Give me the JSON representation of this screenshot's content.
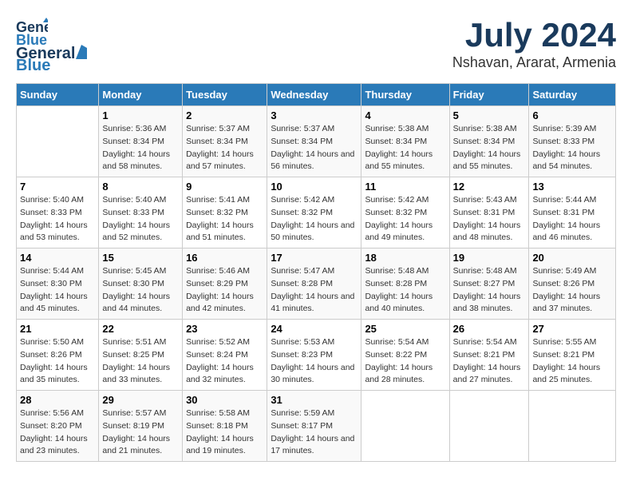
{
  "header": {
    "logo_line1": "General",
    "logo_line2": "Blue",
    "title": "July 2024",
    "subtitle": "Nshavan, Ararat, Armenia"
  },
  "weekdays": [
    "Sunday",
    "Monday",
    "Tuesday",
    "Wednesday",
    "Thursday",
    "Friday",
    "Saturday"
  ],
  "weeks": [
    [
      {
        "day": "",
        "sunrise": "",
        "sunset": "",
        "daylight": ""
      },
      {
        "day": "1",
        "sunrise": "Sunrise: 5:36 AM",
        "sunset": "Sunset: 8:34 PM",
        "daylight": "Daylight: 14 hours and 58 minutes."
      },
      {
        "day": "2",
        "sunrise": "Sunrise: 5:37 AM",
        "sunset": "Sunset: 8:34 PM",
        "daylight": "Daylight: 14 hours and 57 minutes."
      },
      {
        "day": "3",
        "sunrise": "Sunrise: 5:37 AM",
        "sunset": "Sunset: 8:34 PM",
        "daylight": "Daylight: 14 hours and 56 minutes."
      },
      {
        "day": "4",
        "sunrise": "Sunrise: 5:38 AM",
        "sunset": "Sunset: 8:34 PM",
        "daylight": "Daylight: 14 hours and 55 minutes."
      },
      {
        "day": "5",
        "sunrise": "Sunrise: 5:38 AM",
        "sunset": "Sunset: 8:34 PM",
        "daylight": "Daylight: 14 hours and 55 minutes."
      },
      {
        "day": "6",
        "sunrise": "Sunrise: 5:39 AM",
        "sunset": "Sunset: 8:33 PM",
        "daylight": "Daylight: 14 hours and 54 minutes."
      }
    ],
    [
      {
        "day": "7",
        "sunrise": "Sunrise: 5:40 AM",
        "sunset": "Sunset: 8:33 PM",
        "daylight": "Daylight: 14 hours and 53 minutes."
      },
      {
        "day": "8",
        "sunrise": "Sunrise: 5:40 AM",
        "sunset": "Sunset: 8:33 PM",
        "daylight": "Daylight: 14 hours and 52 minutes."
      },
      {
        "day": "9",
        "sunrise": "Sunrise: 5:41 AM",
        "sunset": "Sunset: 8:32 PM",
        "daylight": "Daylight: 14 hours and 51 minutes."
      },
      {
        "day": "10",
        "sunrise": "Sunrise: 5:42 AM",
        "sunset": "Sunset: 8:32 PM",
        "daylight": "Daylight: 14 hours and 50 minutes."
      },
      {
        "day": "11",
        "sunrise": "Sunrise: 5:42 AM",
        "sunset": "Sunset: 8:32 PM",
        "daylight": "Daylight: 14 hours and 49 minutes."
      },
      {
        "day": "12",
        "sunrise": "Sunrise: 5:43 AM",
        "sunset": "Sunset: 8:31 PM",
        "daylight": "Daylight: 14 hours and 48 minutes."
      },
      {
        "day": "13",
        "sunrise": "Sunrise: 5:44 AM",
        "sunset": "Sunset: 8:31 PM",
        "daylight": "Daylight: 14 hours and 46 minutes."
      }
    ],
    [
      {
        "day": "14",
        "sunrise": "Sunrise: 5:44 AM",
        "sunset": "Sunset: 8:30 PM",
        "daylight": "Daylight: 14 hours and 45 minutes."
      },
      {
        "day": "15",
        "sunrise": "Sunrise: 5:45 AM",
        "sunset": "Sunset: 8:30 PM",
        "daylight": "Daylight: 14 hours and 44 minutes."
      },
      {
        "day": "16",
        "sunrise": "Sunrise: 5:46 AM",
        "sunset": "Sunset: 8:29 PM",
        "daylight": "Daylight: 14 hours and 42 minutes."
      },
      {
        "day": "17",
        "sunrise": "Sunrise: 5:47 AM",
        "sunset": "Sunset: 8:28 PM",
        "daylight": "Daylight: 14 hours and 41 minutes."
      },
      {
        "day": "18",
        "sunrise": "Sunrise: 5:48 AM",
        "sunset": "Sunset: 8:28 PM",
        "daylight": "Daylight: 14 hours and 40 minutes."
      },
      {
        "day": "19",
        "sunrise": "Sunrise: 5:48 AM",
        "sunset": "Sunset: 8:27 PM",
        "daylight": "Daylight: 14 hours and 38 minutes."
      },
      {
        "day": "20",
        "sunrise": "Sunrise: 5:49 AM",
        "sunset": "Sunset: 8:26 PM",
        "daylight": "Daylight: 14 hours and 37 minutes."
      }
    ],
    [
      {
        "day": "21",
        "sunrise": "Sunrise: 5:50 AM",
        "sunset": "Sunset: 8:26 PM",
        "daylight": "Daylight: 14 hours and 35 minutes."
      },
      {
        "day": "22",
        "sunrise": "Sunrise: 5:51 AM",
        "sunset": "Sunset: 8:25 PM",
        "daylight": "Daylight: 14 hours and 33 minutes."
      },
      {
        "day": "23",
        "sunrise": "Sunrise: 5:52 AM",
        "sunset": "Sunset: 8:24 PM",
        "daylight": "Daylight: 14 hours and 32 minutes."
      },
      {
        "day": "24",
        "sunrise": "Sunrise: 5:53 AM",
        "sunset": "Sunset: 8:23 PM",
        "daylight": "Daylight: 14 hours and 30 minutes."
      },
      {
        "day": "25",
        "sunrise": "Sunrise: 5:54 AM",
        "sunset": "Sunset: 8:22 PM",
        "daylight": "Daylight: 14 hours and 28 minutes."
      },
      {
        "day": "26",
        "sunrise": "Sunrise: 5:54 AM",
        "sunset": "Sunset: 8:21 PM",
        "daylight": "Daylight: 14 hours and 27 minutes."
      },
      {
        "day": "27",
        "sunrise": "Sunrise: 5:55 AM",
        "sunset": "Sunset: 8:21 PM",
        "daylight": "Daylight: 14 hours and 25 minutes."
      }
    ],
    [
      {
        "day": "28",
        "sunrise": "Sunrise: 5:56 AM",
        "sunset": "Sunset: 8:20 PM",
        "daylight": "Daylight: 14 hours and 23 minutes."
      },
      {
        "day": "29",
        "sunrise": "Sunrise: 5:57 AM",
        "sunset": "Sunset: 8:19 PM",
        "daylight": "Daylight: 14 hours and 21 minutes."
      },
      {
        "day": "30",
        "sunrise": "Sunrise: 5:58 AM",
        "sunset": "Sunset: 8:18 PM",
        "daylight": "Daylight: 14 hours and 19 minutes."
      },
      {
        "day": "31",
        "sunrise": "Sunrise: 5:59 AM",
        "sunset": "Sunset: 8:17 PM",
        "daylight": "Daylight: 14 hours and 17 minutes."
      },
      {
        "day": "",
        "sunrise": "",
        "sunset": "",
        "daylight": ""
      },
      {
        "day": "",
        "sunrise": "",
        "sunset": "",
        "daylight": ""
      },
      {
        "day": "",
        "sunrise": "",
        "sunset": "",
        "daylight": ""
      }
    ]
  ]
}
